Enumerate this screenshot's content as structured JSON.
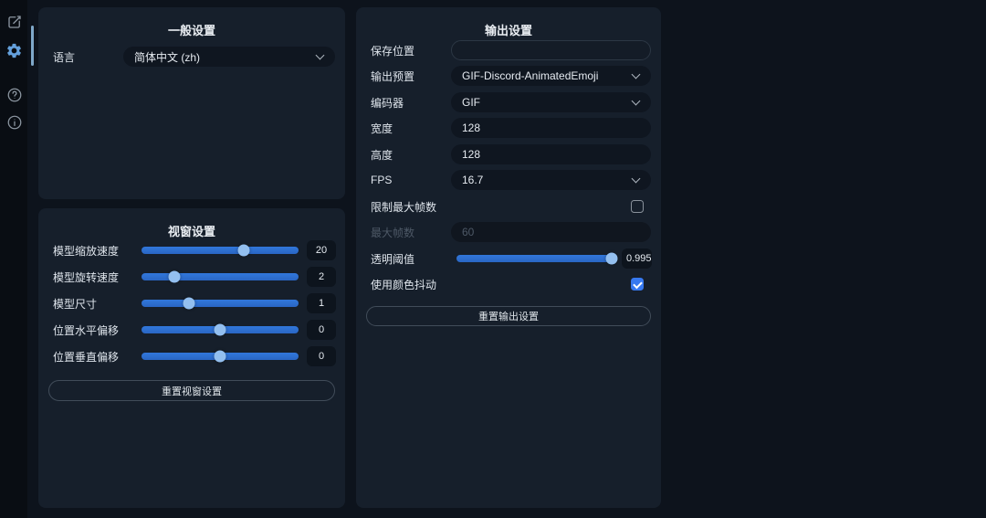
{
  "sidebar": {
    "items": [
      {
        "name": "edit"
      },
      {
        "name": "settings",
        "active": true
      },
      {
        "name": "help"
      },
      {
        "name": "info"
      }
    ]
  },
  "general": {
    "title": "一般设置",
    "language_label": "语言",
    "language_value": "简体中文 (zh)"
  },
  "viewport": {
    "title": "视窗设置",
    "sliders": [
      {
        "label": "模型缩放速度",
        "value": "20",
        "percent": 65
      },
      {
        "label": "模型旋转速度",
        "value": "2",
        "percent": 21
      },
      {
        "label": "模型尺寸",
        "value": "1",
        "percent": 30
      },
      {
        "label": "位置水平偏移",
        "value": "0",
        "percent": 50
      },
      {
        "label": "位置垂直偏移",
        "value": "0",
        "percent": 50
      }
    ],
    "reset_label": "重置视窗设置"
  },
  "output": {
    "title": "输出设置",
    "save_location_label": "保存位置",
    "save_location_value": "",
    "preset_label": "输出预置",
    "preset_value": "GIF-Discord-AnimatedEmoji",
    "encoder_label": "编码器",
    "encoder_value": "GIF",
    "width_label": "宽度",
    "width_value": "128",
    "height_label": "高度",
    "height_value": "128",
    "fps_label": "FPS",
    "fps_value": "16.7",
    "limit_frames_label": "限制最大帧数",
    "limit_frames_checked": false,
    "max_frames_label": "最大帧数",
    "max_frames_value": "60",
    "alpha_label": "透明阈值",
    "alpha_value": "0.995",
    "alpha_percent": 97,
    "dither_label": "使用颜色抖动",
    "dither_checked": true,
    "reset_label": "重置输出设置"
  },
  "colors": {
    "accent_blue": "#2d6fd3",
    "thumb_blue": "#93bfef",
    "checkbox_blue": "#3779f0",
    "panel_bg": "#161f2b",
    "page_bg": "#0d131c"
  }
}
